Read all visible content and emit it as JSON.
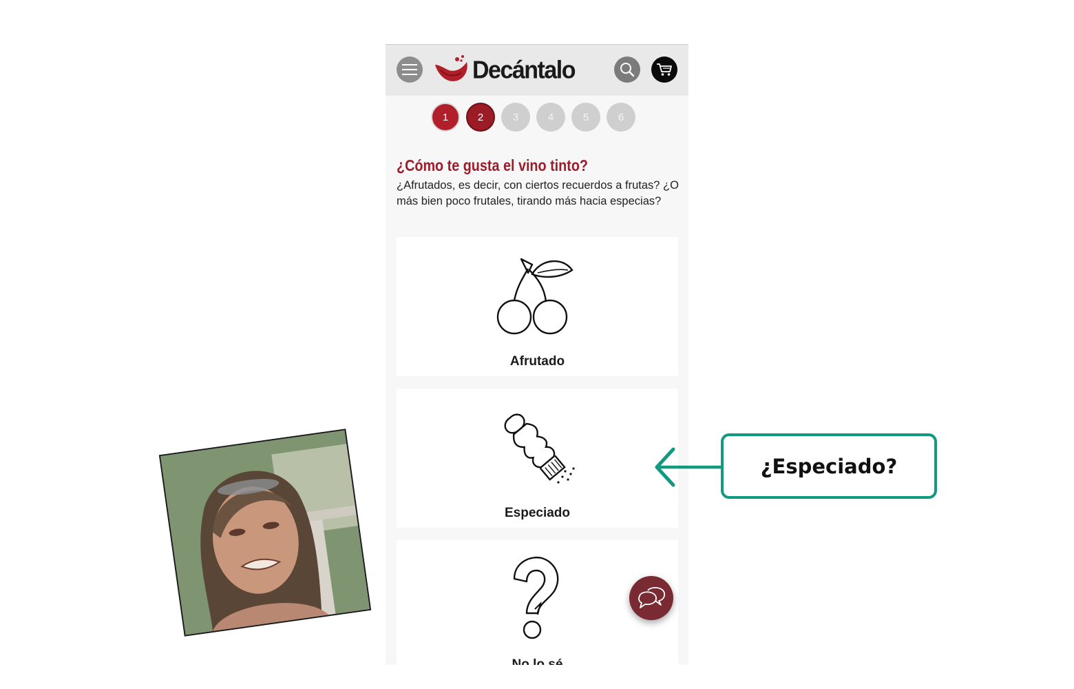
{
  "header": {
    "brand": "Decántalo",
    "menu_icon": "hamburger-menu-icon",
    "search_icon": "search-icon",
    "cart_icon": "cart-icon"
  },
  "steps": [
    "1",
    "2",
    "3",
    "4",
    "5",
    "6"
  ],
  "current_step": 2,
  "question": {
    "title": "¿Cómo te gusta el vino tinto?",
    "description": "¿Afrutados, es decir, con ciertos recuerdos a frutas? ¿O más bien poco frutales, tirando más hacia especias?"
  },
  "options": [
    {
      "label": "Afrutado",
      "icon": "cherry-icon"
    },
    {
      "label": "Especiado",
      "icon": "pepper-shaker-icon"
    },
    {
      "label": "No lo sé",
      "icon": "question-mark-icon"
    }
  ],
  "chat": {
    "icon": "chat-bubbles-icon"
  },
  "annotation": {
    "text": "¿Especiado?",
    "color": "#129a80"
  },
  "colors": {
    "brand_red": "#9e1c29",
    "step_active": "#b01f2a",
    "step_todo": "#cfcfcf",
    "chat_button": "#7a2a33"
  }
}
